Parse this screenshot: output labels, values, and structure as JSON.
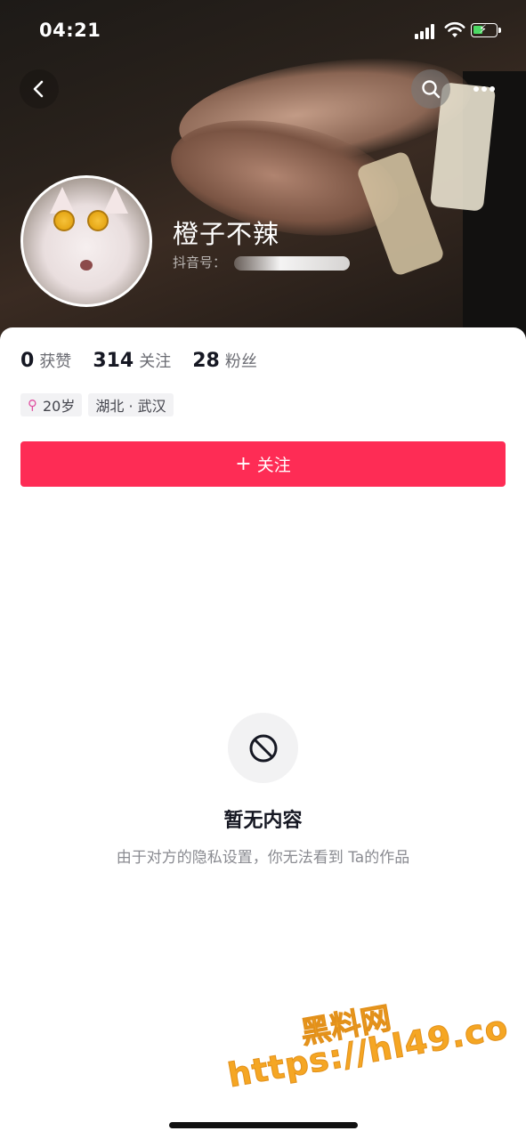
{
  "status_bar": {
    "time": "04:21"
  },
  "profile": {
    "nickname": "橙子不辣",
    "douyin_id_label": "抖音号：",
    "stats": [
      {
        "value": "0",
        "label": "获赞"
      },
      {
        "value": "314",
        "label": "关注"
      },
      {
        "value": "28",
        "label": "粉丝"
      }
    ],
    "tags": {
      "age": "20岁",
      "location": "湖北 · 武汉"
    },
    "follow_label": "关注"
  },
  "empty_state": {
    "title": "暂无内容",
    "description": "由于对方的隐私设置，你无法看到 Ta的作品"
  },
  "watermark": {
    "site_name": "黑料网",
    "url": "https://hl49.co"
  },
  "colors": {
    "accent": "#fe2c55",
    "battery": "#4cd964",
    "watermark": "#f5a623"
  },
  "icons": [
    "back-arrow-icon",
    "search-icon",
    "more-icon",
    "female-icon",
    "plus-icon",
    "block-icon",
    "signal-icon",
    "wifi-icon",
    "battery-icon"
  ]
}
